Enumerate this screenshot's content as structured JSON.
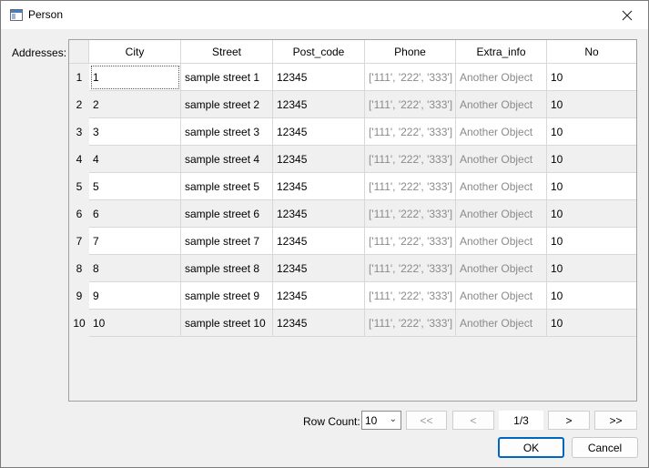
{
  "window": {
    "title": "Person"
  },
  "addresses_label": "Addresses:",
  "table": {
    "columns": [
      "City",
      "Street",
      "Post_code",
      "Phone",
      "Extra_info",
      "No"
    ],
    "rows": [
      {
        "num": "1",
        "city": "1",
        "street": "sample street 1",
        "post_code": "12345",
        "phone": "['111', '222', '333']",
        "extra_info": "Another Object",
        "no": "10"
      },
      {
        "num": "2",
        "city": "2",
        "street": "sample street 2",
        "post_code": "12345",
        "phone": "['111', '222', '333']",
        "extra_info": "Another Object",
        "no": "10"
      },
      {
        "num": "3",
        "city": "3",
        "street": "sample street 3",
        "post_code": "12345",
        "phone": "['111', '222', '333']",
        "extra_info": "Another Object",
        "no": "10"
      },
      {
        "num": "4",
        "city": "4",
        "street": "sample street 4",
        "post_code": "12345",
        "phone": "['111', '222', '333']",
        "extra_info": "Another Object",
        "no": "10"
      },
      {
        "num": "5",
        "city": "5",
        "street": "sample street 5",
        "post_code": "12345",
        "phone": "['111', '222', '333']",
        "extra_info": "Another Object",
        "no": "10"
      },
      {
        "num": "6",
        "city": "6",
        "street": "sample street 6",
        "post_code": "12345",
        "phone": "['111', '222', '333']",
        "extra_info": "Another Object",
        "no": "10"
      },
      {
        "num": "7",
        "city": "7",
        "street": "sample street 7",
        "post_code": "12345",
        "phone": "['111', '222', '333']",
        "extra_info": "Another Object",
        "no": "10"
      },
      {
        "num": "8",
        "city": "8",
        "street": "sample street 8",
        "post_code": "12345",
        "phone": "['111', '222', '333']",
        "extra_info": "Another Object",
        "no": "10"
      },
      {
        "num": "9",
        "city": "9",
        "street": "sample street 9",
        "post_code": "12345",
        "phone": "['111', '222', '333']",
        "extra_info": "Another Object",
        "no": "10"
      },
      {
        "num": "10",
        "city": "10",
        "street": "sample street 10",
        "post_code": "12345",
        "phone": "['111', '222', '333']",
        "extra_info": "Another Object",
        "no": "10"
      }
    ]
  },
  "pagination": {
    "row_count_label": "Row Count:",
    "row_count_value": "10",
    "first": "<<",
    "prev": "<",
    "page": "1/3",
    "next": ">",
    "last": ">>"
  },
  "buttons": {
    "ok": "OK",
    "cancel": "Cancel"
  },
  "colors": {
    "accent": "#0067c0",
    "muted_text": "#8a8a8a"
  }
}
